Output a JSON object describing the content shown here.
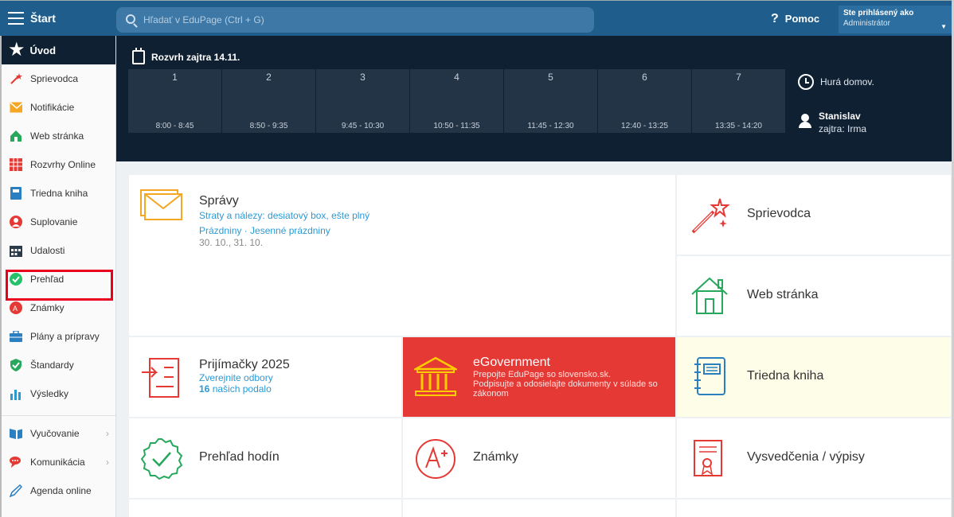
{
  "topbar": {
    "start_label": "Štart",
    "search_placeholder": "Hľadať v EduPage (Ctrl + G)",
    "help_icon": "?",
    "help_label": "Pomoc",
    "user_line1": "Ste prihlásený ako",
    "user_line2": "Administrátor"
  },
  "sidebar": {
    "header": "Úvod",
    "items": [
      {
        "label": "Sprievodca",
        "icon": "magic-wand-icon",
        "color": "#e53935"
      },
      {
        "label": "Notifikácie",
        "icon": "envelope-icon",
        "color": "#f5a623"
      },
      {
        "label": "Web stránka",
        "icon": "house-icon",
        "color": "#27a85d"
      },
      {
        "label": "Rozvrhy Online",
        "icon": "timetable-icon",
        "color": "#e53935"
      },
      {
        "label": "Triedna kniha",
        "icon": "book-icon",
        "color": "#2a7fc1"
      },
      {
        "label": "Suplovanie",
        "icon": "substitute-icon",
        "color": "#e53935"
      },
      {
        "label": "Udalosti",
        "icon": "calendar-icon",
        "color": "#2b3a4a"
      },
      {
        "label": "Prehľad",
        "icon": "check-circle-icon",
        "color": "#27c06a"
      },
      {
        "label": "Známky",
        "icon": "grade-icon",
        "color": "#e53935"
      },
      {
        "label": "Plány a prípravy",
        "icon": "briefcase-icon",
        "color": "#2a7fc1"
      },
      {
        "label": "Štandardy",
        "icon": "shield-check-icon",
        "color": "#27a85d"
      },
      {
        "label": "Výsledky",
        "icon": "bar-chart-icon",
        "color": "#2a9ad6"
      }
    ],
    "groups": [
      {
        "label": "Vyučovanie",
        "icon": "open-book-icon",
        "color": "#2a7fc1"
      },
      {
        "label": "Komunikácia",
        "icon": "chat-icon",
        "color": "#e53935"
      },
      {
        "label": "Agenda online",
        "icon": "pen-icon",
        "color": "#2a7fc1"
      }
    ]
  },
  "timetable": {
    "title": "Rozvrh zajtra 14.11.",
    "periods": [
      {
        "num": "1",
        "time": "8:00 - 8:45"
      },
      {
        "num": "2",
        "time": "8:50 - 9:35"
      },
      {
        "num": "3",
        "time": "9:45 - 10:30"
      },
      {
        "num": "4",
        "time": "10:50 - 11:35"
      },
      {
        "num": "5",
        "time": "11:45 - 12:30"
      },
      {
        "num": "6",
        "time": "12:40 - 13:25"
      },
      {
        "num": "7",
        "time": "13:35 - 14:20"
      }
    ],
    "home_label": "Hurá domov.",
    "sub_name": "Stanislav",
    "sub_detail": "zajtra: Irma"
  },
  "tiles": {
    "spravy": {
      "title": "Správy",
      "line1": "Straty a nálezy: desiatový box, ešte plný",
      "line2": "Prázdniny · Jesenné prázdniny",
      "line3": "30. 10., 31. 10."
    },
    "sprievodca": "Sprievodca",
    "web": "Web stránka",
    "prijimacky": {
      "title": "Prijímačky 2025",
      "line1": "Zverejnite odbory",
      "count": "16",
      "line2": "našich podalo"
    },
    "egov": {
      "title": "eGovernment",
      "line1": "Prepojte EduPage so slovensko.sk.",
      "line2": "Podpisujte a odosielajte dokumenty v súlade so zákonom"
    },
    "triedna": "Triedna kniha",
    "prehlad": "Prehľad hodín",
    "znamky": "Známky",
    "vysvedcenia": "Vysvedčenia / výpisy"
  }
}
